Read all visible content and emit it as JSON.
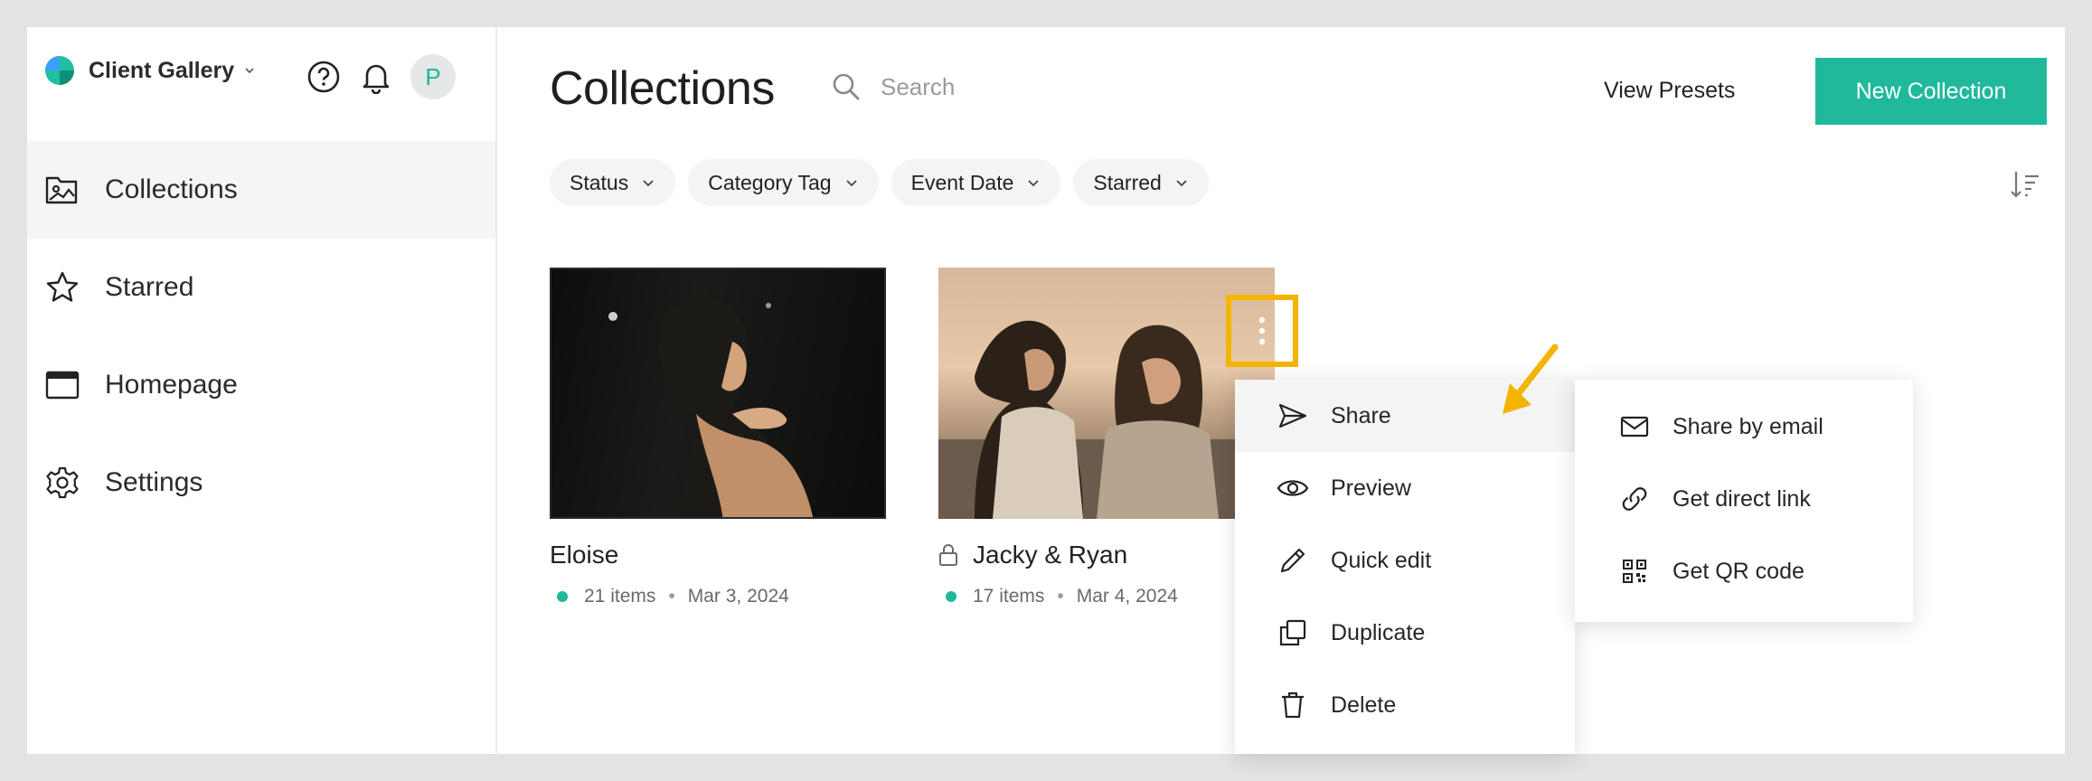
{
  "sidebar": {
    "brand": "Client Gallery",
    "avatar_initial": "P",
    "items": [
      {
        "label": "Collections",
        "icon": "image-folder-icon",
        "active": true
      },
      {
        "label": "Starred",
        "icon": "star-icon"
      },
      {
        "label": "Homepage",
        "icon": "browser-window-icon"
      },
      {
        "label": "Settings",
        "icon": "gear-icon"
      }
    ]
  },
  "header": {
    "title": "Collections",
    "search_placeholder": "Search",
    "view_presets": "View Presets",
    "new_collection": "New Collection"
  },
  "filters": [
    "Status",
    "Category Tag",
    "Event Date",
    "Starred"
  ],
  "collections": [
    {
      "title": "Eloise",
      "items": "21 items",
      "date": "Mar 3, 2024",
      "locked": false
    },
    {
      "title": "Jacky & Ryan",
      "items": "17 items",
      "date": "Mar 4, 2024",
      "locked": true
    }
  ],
  "context_menu": {
    "items": [
      "Share",
      "Preview",
      "Quick edit",
      "Duplicate",
      "Delete"
    ]
  },
  "share_submenu": {
    "items": [
      "Share by email",
      "Get direct link",
      "Get QR code"
    ]
  },
  "colors": {
    "accent": "#20b99b",
    "highlight": "#f4b400"
  }
}
